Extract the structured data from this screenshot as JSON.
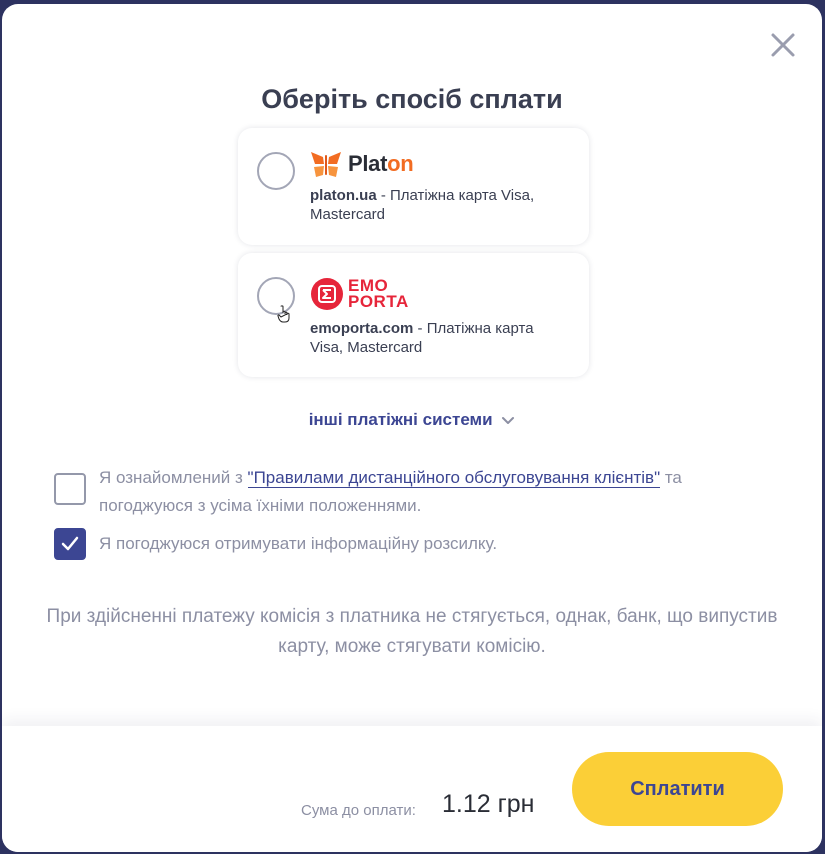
{
  "modal": {
    "title": "Оберіть спосіб сплати",
    "close_icon": "close-icon"
  },
  "payment_methods": [
    {
      "logo_text_main": "Plat",
      "logo_text_accent": "on",
      "site": "platon.ua",
      "description": " - Платіжна карта Visa, Mastercard",
      "selected": false,
      "logo_colors": {
        "accent": "#f26c22",
        "text": "#2a2d36"
      }
    },
    {
      "logo_line1": "EMO",
      "logo_line2": "PORTA",
      "site": "emoporta.com",
      "description": " - Платіжна карта Visa, Mastercard",
      "selected": false,
      "logo_colors": {
        "accent": "#e6253a"
      }
    }
  ],
  "other_systems": {
    "label": "інші платіжні системи",
    "icon": "chevron-down-icon"
  },
  "agreements": {
    "rules_prefix": "Я ознайомлений з ",
    "rules_link": "\"Правилами дистанційного обслуговування клієнтів\"",
    "rules_suffix": " та погоджуюся з усіма їхніми положеннями.",
    "rules_checked": false,
    "newsletter": "Я погоджуюся отримувати інформаційну розсилку.",
    "newsletter_checked": true
  },
  "note": "При здійсненні платежу комісія з платника не стягується, однак, банк, що випустив карту, може стягувати комісію.",
  "footer": {
    "sum_label": "Сума до оплати:",
    "sum_value": "1.12 грн",
    "pay_button": "Сплатити"
  },
  "colors": {
    "primary": "#3c4693",
    "button": "#fbcf37",
    "backdrop": "#2d3260",
    "muted_text": "#8c8fa3"
  }
}
